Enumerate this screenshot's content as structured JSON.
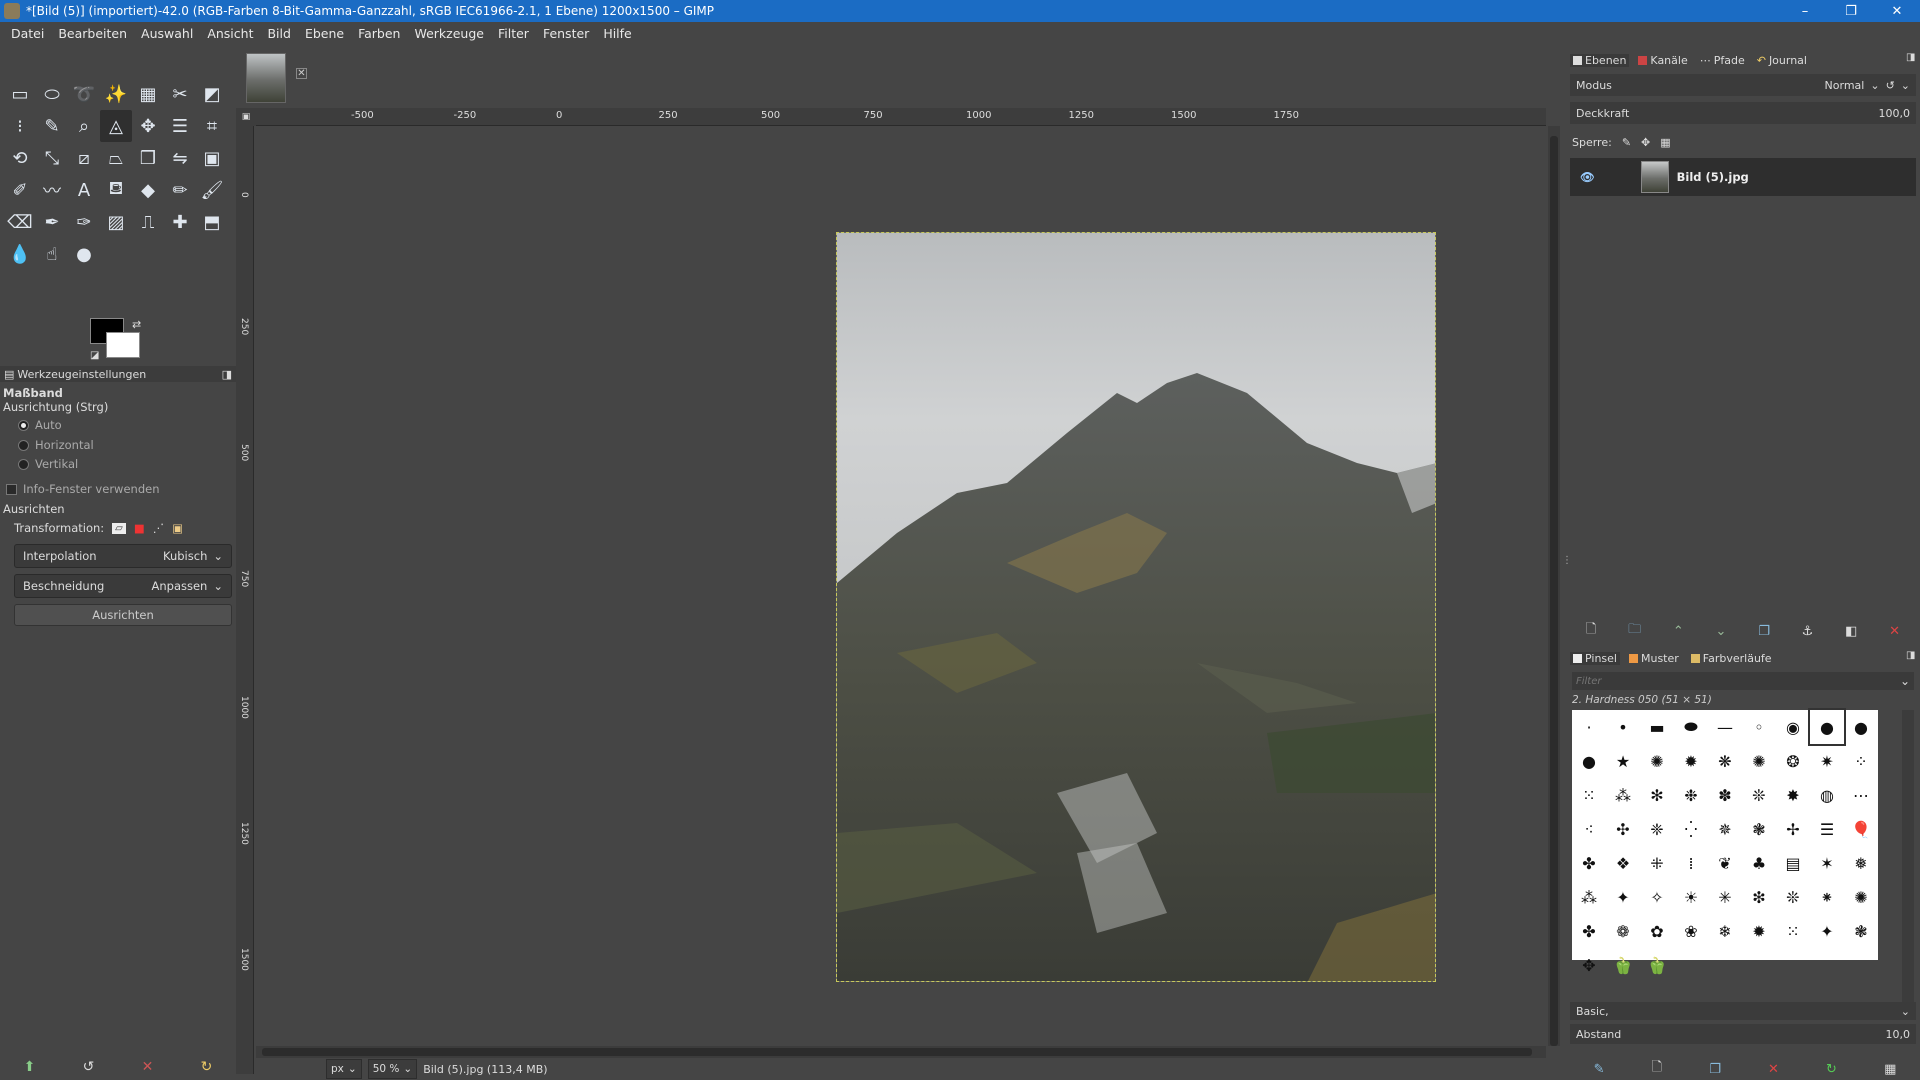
{
  "window": {
    "title": "*[Bild (5)] (importiert)-42.0 (RGB-Farben 8-Bit-Gamma-Ganzzahl, sRGB IEC61966-2.1, 1 Ebene) 1200x1500 – GIMP",
    "minimize": "–",
    "maximize": "❐",
    "close": "✕"
  },
  "menu": [
    "Datei",
    "Bearbeiten",
    "Auswahl",
    "Ansicht",
    "Bild",
    "Ebene",
    "Farben",
    "Werkzeuge",
    "Filter",
    "Fenster",
    "Hilfe"
  ],
  "tools": [
    {
      "name": "rect-select-icon",
      "glyph": "▭"
    },
    {
      "name": "ellipse-select-icon",
      "glyph": "⬭"
    },
    {
      "name": "lasso-icon",
      "glyph": "➰"
    },
    {
      "name": "fuzzy-select-icon",
      "glyph": "✨"
    },
    {
      "name": "color-select-icon",
      "glyph": "▦"
    },
    {
      "name": "scissors-icon",
      "glyph": "✂"
    },
    {
      "name": "foreground-select-icon",
      "glyph": "◩"
    },
    {
      "name": "align-icon",
      "glyph": "⁝"
    },
    {
      "name": "color-picker-icon",
      "glyph": "✎"
    },
    {
      "name": "zoom-icon",
      "glyph": "⌕"
    },
    {
      "name": "measure-icon",
      "glyph": "◬"
    },
    {
      "name": "move-icon",
      "glyph": "✥"
    },
    {
      "name": "align-distribute-icon",
      "glyph": "☰"
    },
    {
      "name": "crop-icon",
      "glyph": "⌗"
    },
    {
      "name": "rotate-icon",
      "glyph": "⟲"
    },
    {
      "name": "scale-icon",
      "glyph": "⤡"
    },
    {
      "name": "shear-icon",
      "glyph": "⧄"
    },
    {
      "name": "perspective-icon",
      "glyph": "⏢"
    },
    {
      "name": "3d-transform-icon",
      "glyph": "❒"
    },
    {
      "name": "flip-icon",
      "glyph": "⇋"
    },
    {
      "name": "cage-icon",
      "glyph": "▣"
    },
    {
      "name": "paths-icon",
      "glyph": "✐"
    },
    {
      "name": "warp-icon",
      "glyph": "〰"
    },
    {
      "name": "text-icon",
      "glyph": "A"
    },
    {
      "name": "bucket-fill-icon",
      "glyph": "⛾"
    },
    {
      "name": "gradient-icon",
      "glyph": "◆"
    },
    {
      "name": "pencil-icon",
      "glyph": "✏"
    },
    {
      "name": "paintbrush-icon",
      "glyph": "🖌"
    },
    {
      "name": "eraser-icon",
      "glyph": "⌫"
    },
    {
      "name": "airbrush-icon",
      "glyph": "✒"
    },
    {
      "name": "ink-icon",
      "glyph": "✑"
    },
    {
      "name": "mypaint-icon",
      "glyph": "▨"
    },
    {
      "name": "clone-icon",
      "glyph": "⎍"
    },
    {
      "name": "heal-icon",
      "glyph": "✚"
    },
    {
      "name": "perspective-clone-icon",
      "glyph": "⬒"
    },
    {
      "name": "blur-icon",
      "glyph": "💧"
    },
    {
      "name": "smudge-icon",
      "glyph": "☝"
    },
    {
      "name": "dodge-burn-icon",
      "glyph": "●"
    }
  ],
  "tool_options": {
    "header": "Werkzeugeinstellungen",
    "tool_name": "Maßband",
    "orientation_label": "Ausrichtung (Strg)",
    "radios": [
      {
        "label": "Auto",
        "checked": true
      },
      {
        "label": "Horizontal",
        "checked": false
      },
      {
        "label": "Vertikal",
        "checked": false
      }
    ],
    "info_window": "Info-Fenster verwenden",
    "align_label": "Ausrichten",
    "transform_label": "Transformation:",
    "interpolation_label": "Interpolation",
    "interpolation_value": "Kubisch",
    "clipping_label": "Beschneidung",
    "clipping_value": "Anpassen",
    "align_button": "Ausrichten"
  },
  "ruler": {
    "h_ticks": [
      "-500",
      "-250",
      "0",
      "250",
      "500",
      "750",
      "1000",
      "1250",
      "1500",
      "1750"
    ],
    "v_ticks": [
      "0",
      "250",
      "500",
      "750",
      "1000",
      "1250",
      "1500"
    ]
  },
  "status": {
    "unit": "px",
    "zoom": "50 %",
    "info": "Bild (5).jpg (113,4 MB)"
  },
  "layers_dock": {
    "tabs": [
      "Ebenen",
      "Kanäle",
      "Pfade",
      "Journal"
    ],
    "mode_label": "Modus",
    "mode_value": "Normal",
    "opacity_label": "Deckkraft",
    "opacity_value": "100,0",
    "lock_label": "Sperre:",
    "layer_name": "Bild (5).jpg"
  },
  "brushes_dock": {
    "tabs": [
      "Pinsel",
      "Muster",
      "Farbverläufe"
    ],
    "filter_placeholder": "Filter",
    "selected_brush": "2. Hardness 050 (51 × 51)",
    "preset": "Basic,",
    "spacing_label": "Abstand",
    "spacing_value": "10,0"
  },
  "colors": {
    "titlebar": "#1b6cc4",
    "foreground": "#000000",
    "background": "#ffffff"
  }
}
